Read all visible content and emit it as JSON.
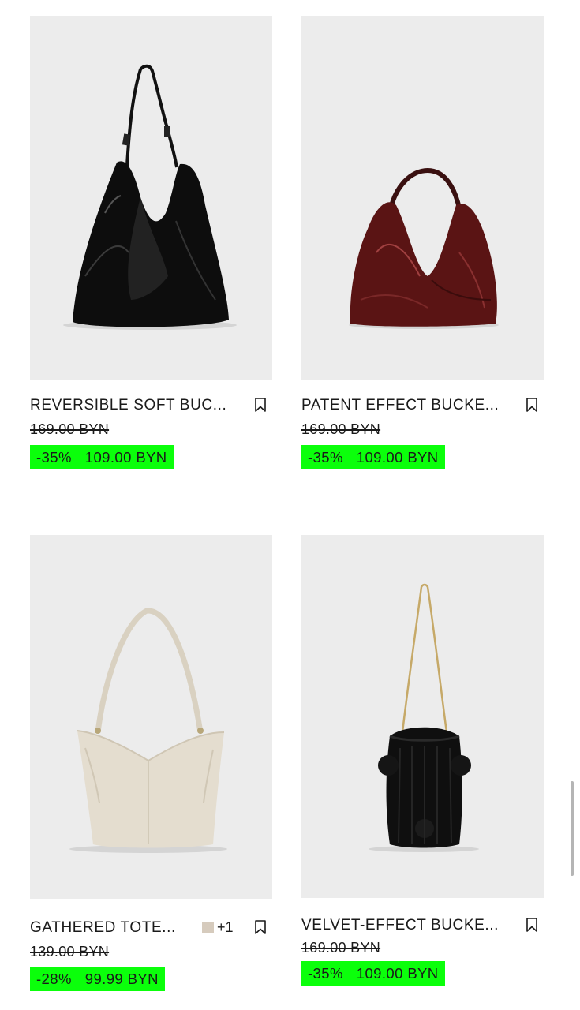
{
  "products": [
    {
      "name": "REVERSIBLE SOFT BUC...",
      "old_price": "169.00 BYN",
      "discount": "-35%",
      "price": "109.00 BYN",
      "icon": "bookmark-icon",
      "bag_color": "#0d0d0d"
    },
    {
      "name": "PATENT EFFECT BUCKE...",
      "old_price": "169.00 BYN",
      "discount": "-35%",
      "price": "109.00 BYN",
      "icon": "bookmark-icon",
      "bag_color": "#5a1414"
    },
    {
      "name": "GATHERED TOTE...",
      "extra_colors": "+1",
      "swatch_color": "#d6cbbd",
      "old_price": "139.00 BYN",
      "discount": "-28%",
      "price": "99.99 BYN",
      "icon": "bookmark-icon",
      "bag_color": "#e4ddcf"
    },
    {
      "name": "VELVET-EFFECT BUCKE...",
      "old_price": "169.00 BYN",
      "discount": "-35%",
      "price": "109.00 BYN",
      "icon": "bookmark-icon",
      "bag_color": "#0f0f0f"
    }
  ],
  "colors": {
    "sale_highlight": "#0bff0b",
    "photo_background": "#ececec",
    "text": "#1a1a1a"
  }
}
